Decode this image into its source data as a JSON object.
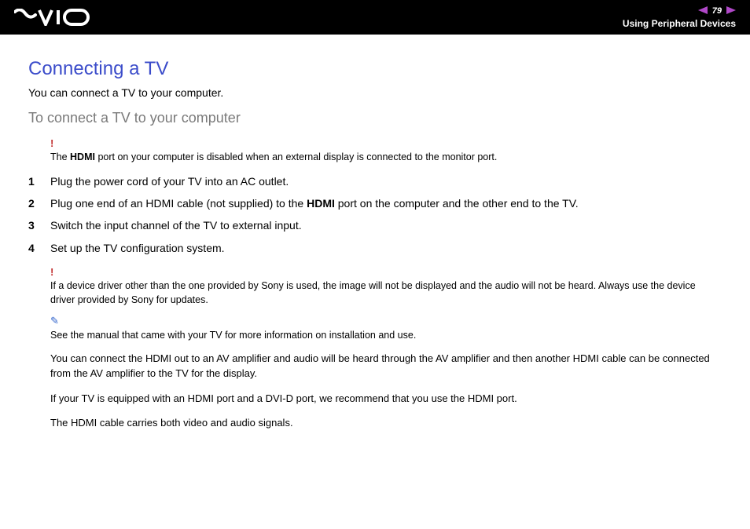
{
  "header": {
    "page_number": "79",
    "breadcrumb": "Using Peripheral Devices"
  },
  "heading": "Connecting a TV",
  "lead": "You can connect a TV to your computer.",
  "subheading": "To connect a TV to your computer",
  "warn1": {
    "pre": "The ",
    "bold": "HDMI",
    "post": " port on your computer is disabled when an external display is connected to the monitor port."
  },
  "steps": [
    {
      "num": "1",
      "text": "Plug the power cord of your TV into an AC outlet."
    },
    {
      "num": "2",
      "pre": "Plug one end of an HDMI cable (not supplied) to the ",
      "bold": "HDMI",
      "post": " port on the computer and the other end to the TV."
    },
    {
      "num": "3",
      "text": "Switch the input channel of the TV to external input."
    },
    {
      "num": "4",
      "text": "Set up the TV configuration system."
    }
  ],
  "warn2": "If a device driver other than the one provided by Sony is used, the image will not be displayed and the audio will not be heard. Always use the device driver provided by Sony for updates.",
  "tip": "See the manual that came with your TV for more information on installation and use.",
  "para1": "You can connect the HDMI out to an AV amplifier and audio will be heard through the AV amplifier and then another HDMI cable can be connected from the AV amplifier to the TV for the display.",
  "para2": "If your TV is equipped with an HDMI port and a DVI-D port, we recommend that you use the HDMI port.",
  "para3": "The HDMI cable carries both video and audio signals.",
  "icons": {
    "warn": "!",
    "tip": "✎"
  }
}
